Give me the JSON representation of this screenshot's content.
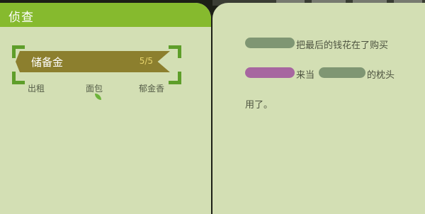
{
  "colors": {
    "accent_green": "#86ba2e",
    "ribbon_brown": "#8c7f2e",
    "blot_green": "#7f9673",
    "blot_purple": "#a766a0"
  },
  "left": {
    "title": "侦查",
    "ribbon": {
      "label": "储备金",
      "count": "5/5"
    },
    "options": [
      "出租",
      "面包",
      "郁金香"
    ]
  },
  "right": {
    "line1": {
      "text": "把最后的钱花在了购买"
    },
    "line2": {
      "text_a": "来当",
      "text_b": "的枕头"
    },
    "line3": {
      "text": "用了。"
    }
  }
}
